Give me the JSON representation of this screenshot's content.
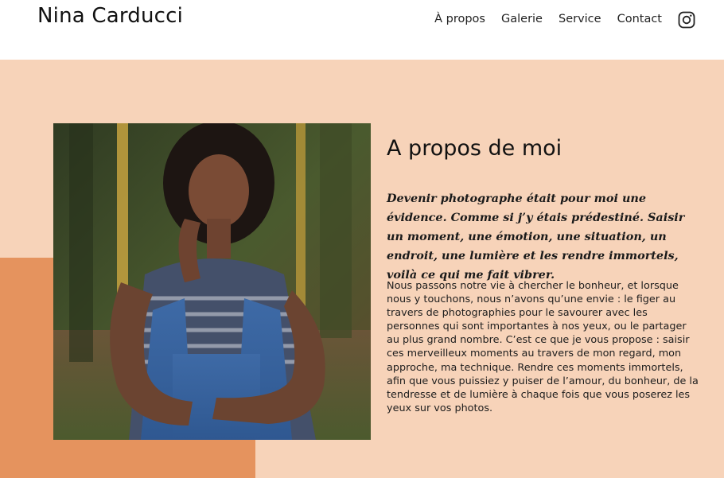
{
  "header": {
    "brand": "Nina Carducci",
    "nav": [
      "À propos",
      "Galerie",
      "Service",
      "Contact"
    ],
    "social_icon": "instagram-icon"
  },
  "about": {
    "title": "A propos de moi",
    "lead": "Devenir photographe était pour moi une évidence. Comme si j’y étais prédestiné. Saisir un moment, une émotion, une situation, un endroit, une lumière et les rendre immortels, voilà ce qui me fait vibrer.",
    "body": "Nous passons notre vie à chercher le bonheur, et lorsque nous y touchons, nous n’avons qu’une envie : le figer au travers de photographies pour le savourer avec les personnes qui sont importantes à nos yeux, ou le partager au plus grand nombre. C’est ce que je vous propose : saisir ces merveilleux moments au travers de mon regard, mon approche, ma technique. Rendre ces moments immortels, afin que vous puissiez y puiser de l’amour, du bonheur, de la tendresse et de lumière à chaque fois que vous poserez les yeux sur vos photos."
  },
  "colors": {
    "section_bg": "#f7d3b9",
    "accent_block": "#e5935e",
    "header_bg": "#ffffff",
    "text": "#111111"
  }
}
